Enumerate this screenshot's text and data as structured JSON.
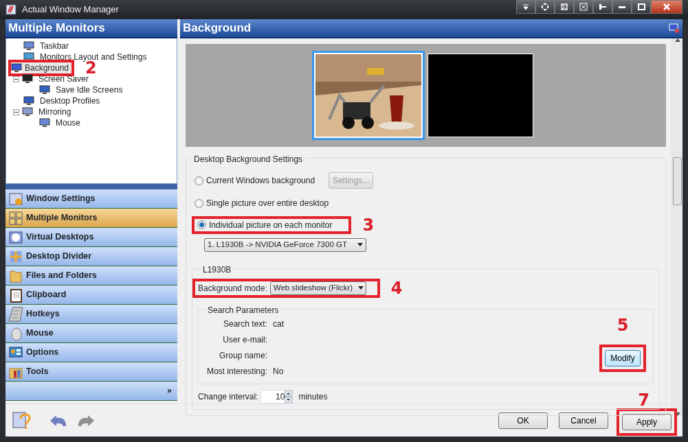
{
  "window": {
    "title": "Actual Window Manager"
  },
  "left_panel": {
    "title": "Multiple Monitors",
    "tree": [
      {
        "label": "Taskbar",
        "selected": false
      },
      {
        "label": "Monitors Layout and Settings",
        "selected": false
      },
      {
        "label": "Background",
        "selected": true,
        "callout": "2"
      },
      {
        "label": "Screen Saver",
        "selected": false,
        "expanded": true,
        "children": [
          {
            "label": "Save Idle Screens",
            "selected": false
          }
        ]
      },
      {
        "label": "Desktop Profiles",
        "selected": false
      },
      {
        "label": "Mirroring",
        "selected": false,
        "expanded": true,
        "children": [
          {
            "label": "Mouse",
            "selected": false
          }
        ]
      }
    ],
    "nav": [
      {
        "label": "Window Settings",
        "selected": false
      },
      {
        "label": "Multiple Monitors",
        "selected": true
      },
      {
        "label": "Virtual Desktops",
        "selected": false
      },
      {
        "label": "Desktop Divider",
        "selected": false
      },
      {
        "label": "Files and Folders",
        "selected": false
      },
      {
        "label": "Clipboard",
        "selected": false
      },
      {
        "label": "Hotkeys",
        "selected": false
      },
      {
        "label": "Mouse",
        "selected": false
      },
      {
        "label": "Options",
        "selected": false
      },
      {
        "label": "Tools",
        "selected": false
      }
    ],
    "more": "»"
  },
  "right_panel": {
    "title": "Background",
    "monitors": [
      {
        "kind": "picture",
        "selected": true
      },
      {
        "kind": "blank",
        "selected": false
      }
    ],
    "settings_group": {
      "title": "Desktop Background Settings",
      "options": [
        {
          "label": "Current Windows background",
          "selected": false,
          "button": "Settings...",
          "button_disabled": true
        },
        {
          "label": "Single picture over entire desktop",
          "selected": false
        },
        {
          "label": "Individual picture on each monitor",
          "selected": true,
          "callout": "3"
        }
      ],
      "monitor_select": "1. L1930B -> NVIDIA GeForce 7300 GT",
      "monitor_group": {
        "title": "L1930B",
        "mode_label": "Background mode:",
        "mode_value": "Web slideshow (Flickr)",
        "mode_callout": "4",
        "search_group": {
          "title": "Search Parameters",
          "params": [
            {
              "label": "Search text:",
              "value": "cat"
            },
            {
              "label": "User e-mail:"
            },
            {
              "label": "Group name:"
            },
            {
              "label": "Most interesting:",
              "value": "No"
            }
          ],
          "modify": "Modify",
          "modify_callout": "5"
        },
        "interval_label": "Change interval:",
        "interval_value": "10",
        "interval_unit": "minutes"
      }
    }
  },
  "footer": {
    "buttons": [
      {
        "label": "OK"
      },
      {
        "label": "Cancel"
      },
      {
        "label": "Apply",
        "callout": "7"
      }
    ]
  }
}
